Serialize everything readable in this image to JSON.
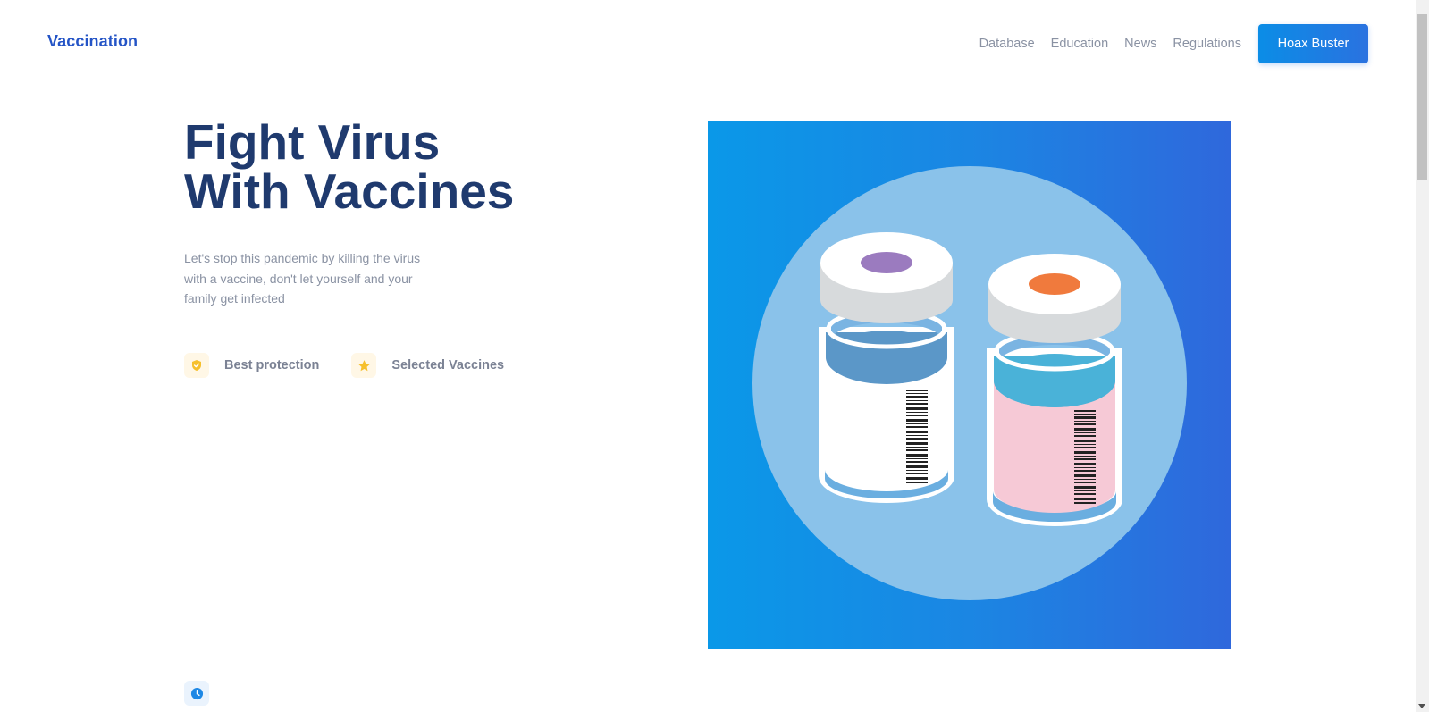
{
  "brand": "Vaccination",
  "nav": {
    "links": [
      "Database",
      "Education",
      "News",
      "Regulations"
    ],
    "cta": "Hoax Buster"
  },
  "hero": {
    "title_line1": "Fight Virus",
    "title_line2": "With Vaccines",
    "subtitle": "Let's stop this pandemic by killing the virus with a vaccine, don't let yourself and your family get infected",
    "features": [
      {
        "icon": "shield-icon",
        "label": "Best protection"
      },
      {
        "icon": "star-icon",
        "label": "Selected Vaccines"
      }
    ],
    "bottom_icon": "clock-icon",
    "image_icon": "vaccine-vials-illustration"
  },
  "colors": {
    "brand": "#2454c6",
    "title": "#1f3a6e",
    "muted": "#8a92a3",
    "accent_blue": "#0b8de6",
    "feature_icon": "#f6c02c",
    "vial_cap_purple": "#9b7bbf",
    "vial_cap_orange": "#f07a3d",
    "vial_liquid_pink": "#f6c9d6"
  }
}
